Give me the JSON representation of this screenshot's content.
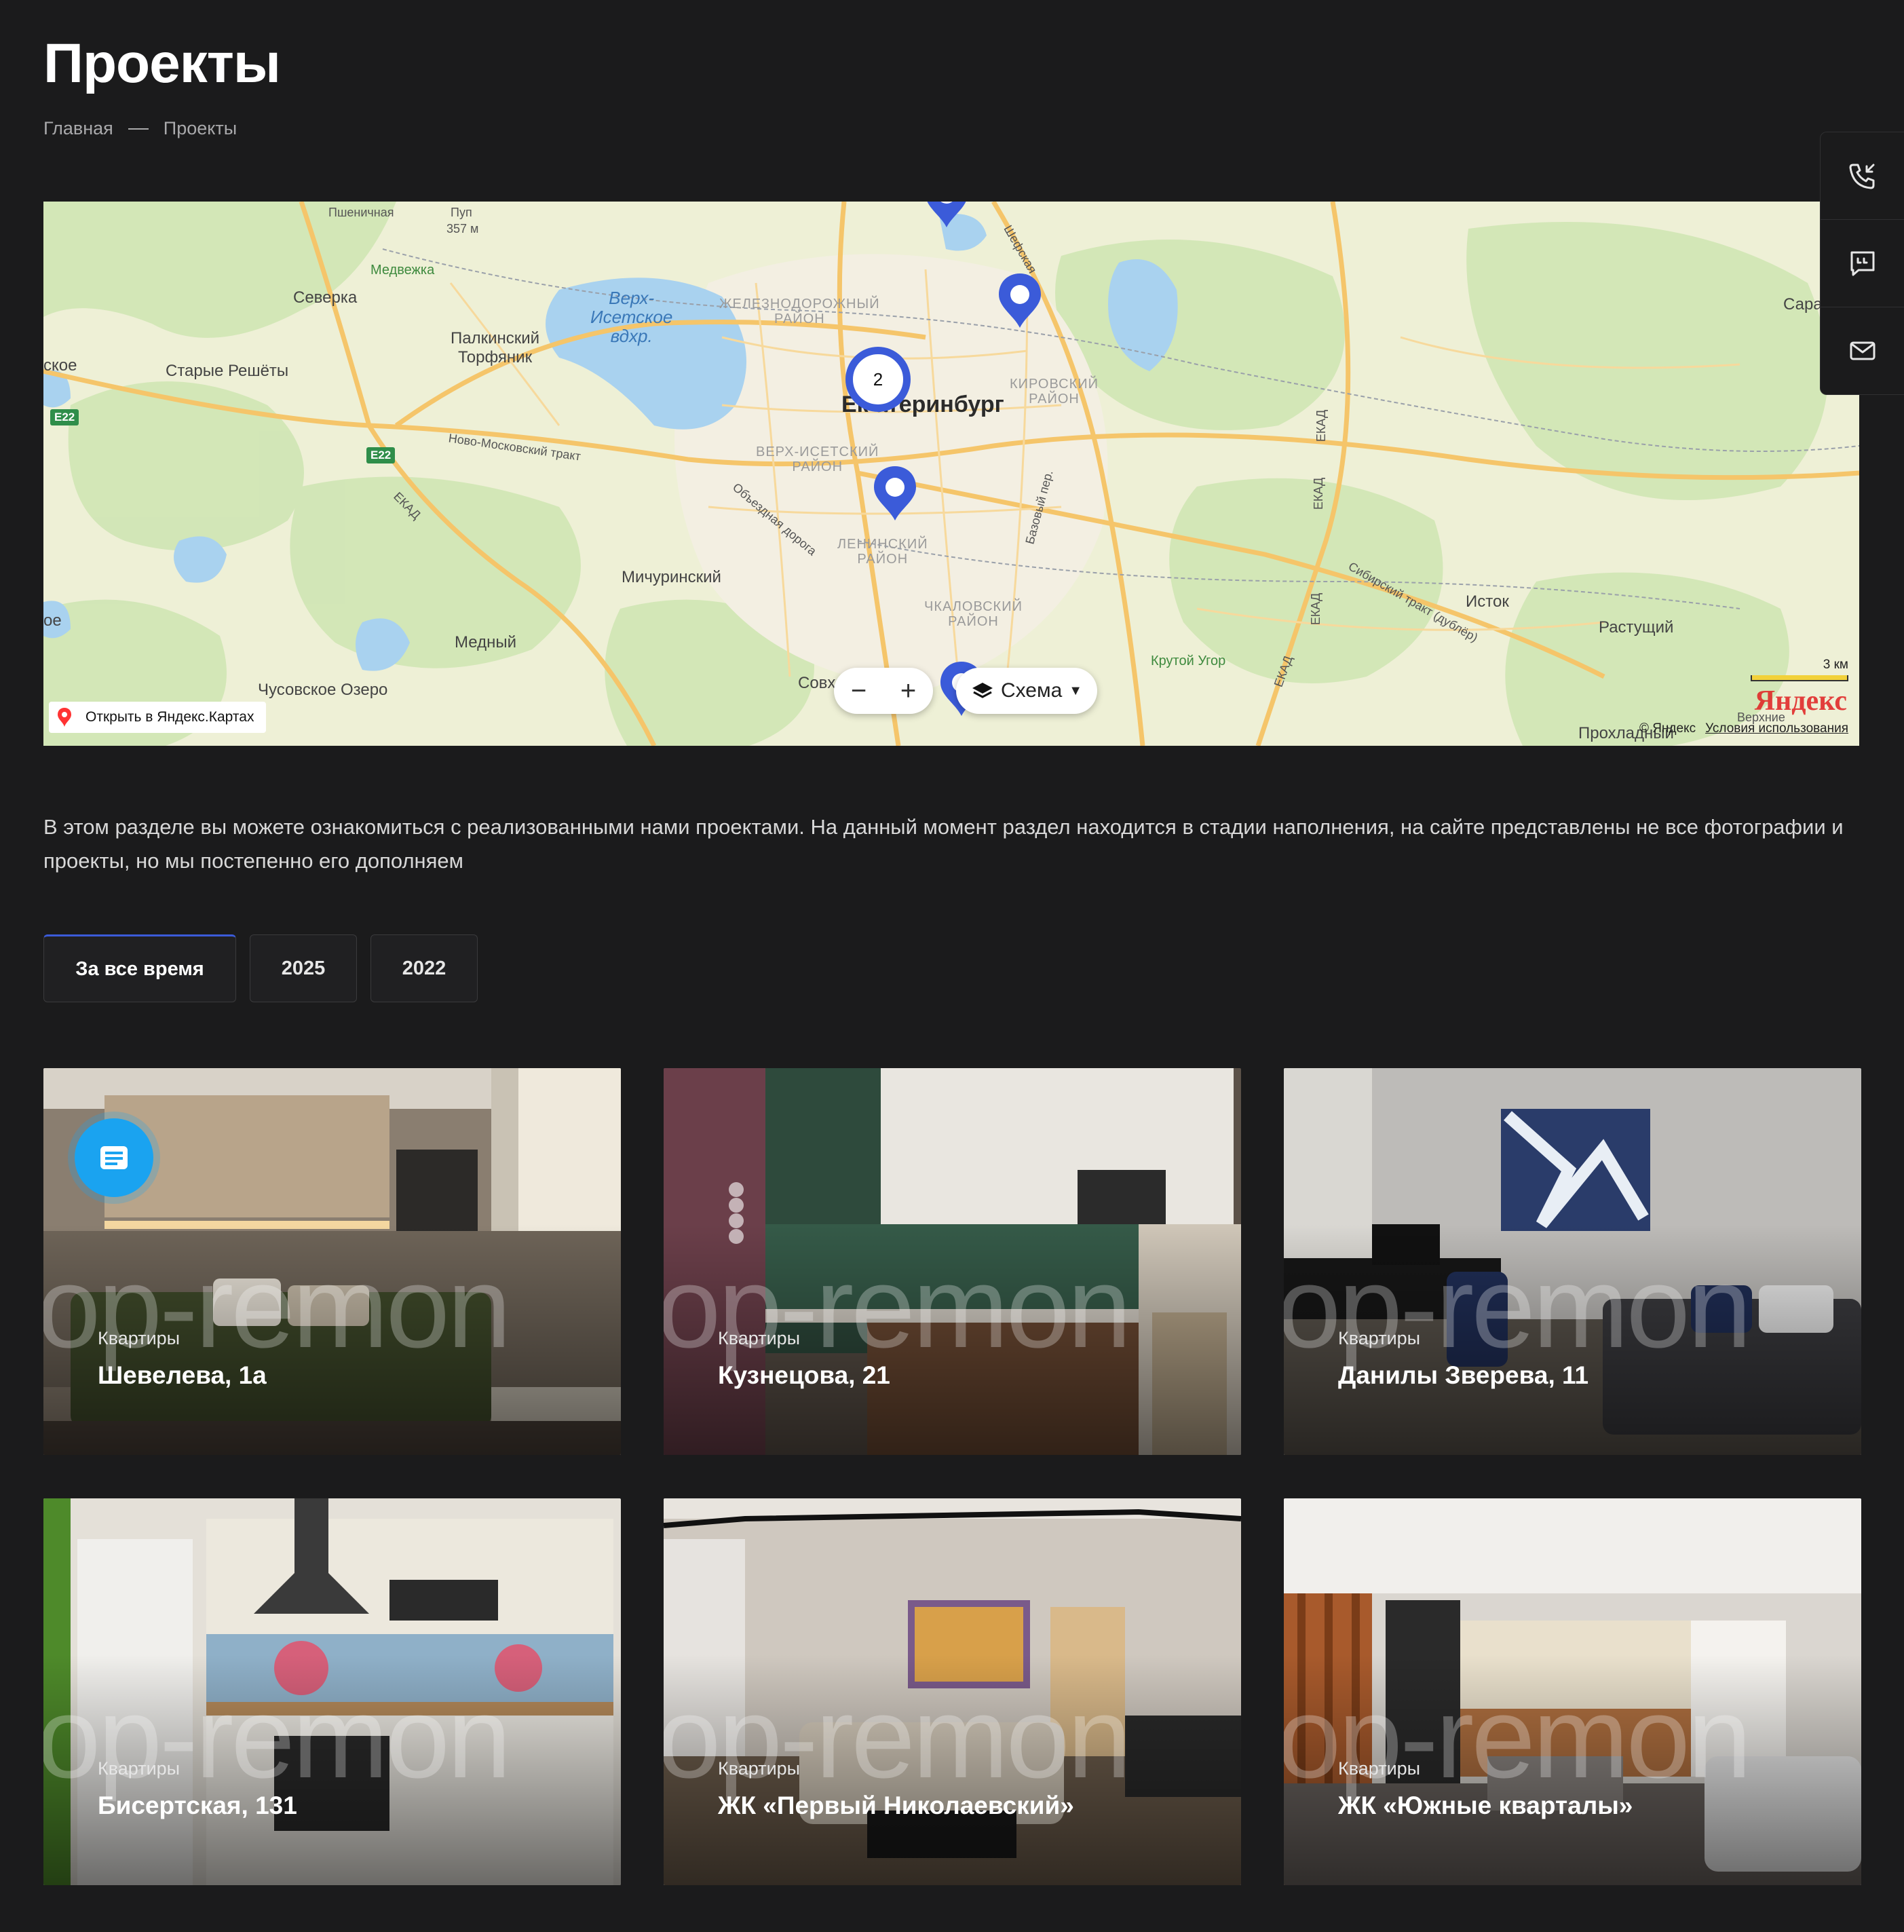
{
  "header": {
    "title": "Проекты"
  },
  "breadcrumb": {
    "home": "Главная",
    "current": "Проекты"
  },
  "map": {
    "labels": {
      "pshenichnaya": "Пшеничная",
      "pup": "Пуп",
      "pup_height": "357 м",
      "medvezhka": "Медвежка",
      "severka": "Северка",
      "reservoir": "Верх-\nИсетское\nвдхр.",
      "zheleznodorozhny": "ЖЕЛЕЗНОДОРОЖНЫЙ\nРАЙОН",
      "shefskaya": "Шефская",
      "palkinsky": "Палкинский\nТорфяник",
      "staroe_left": "ское",
      "starye_reshety": "Старые Решёты",
      "city": "Ек атеринбург",
      "kirovsky": "КИРОВСКИЙ\nРАЙОН",
      "novo_moskovsky": "Ново-Московский тракт",
      "verkh_isetsky": "ВЕРХ-ИСЕТСКИЙ\nРАЙОН",
      "ekad1": "ЕКАД",
      "ekad2": "ЕКАД",
      "ekad3": "ЕКАД",
      "ekad4": "ЕКАД",
      "ekad5": "ЕКАД",
      "obezdnaya": "Объездная дорога",
      "leninsky": "ЛЕНИНСКИЙ\nРАЙОН",
      "bazovy": "Базовый пер.",
      "michurinsky": "Мичуринский",
      "chkalovsky": "ЧКАЛОВСКИЙ\nРАЙОН",
      "sibirsky": "Сибирский тракт (дублёр)",
      "istok": "Исток",
      "rastushchy": "Растущий",
      "medny": "Медный",
      "krutoy_ugor": "Крутой Угор",
      "chusovskoe": "Чусовское Озеро",
      "sovkh": "Совх",
      "sara": "Сара",
      "oe_left": "ое",
      "prokhladny": "Прохладный",
      "verkhnie": "Верхние"
    },
    "road_e22": "E22",
    "cluster_count": "2",
    "zoom_out": "−",
    "zoom_in": "+",
    "scheme_label": "Схема",
    "open_link": "Открыть в Яндекс.Картах",
    "copyright": "© Яндекс",
    "terms": "Условия использования",
    "scale": "3 км",
    "logo": "Яндекс"
  },
  "side_widgets": [
    "phone-callback-icon",
    "chat-quote-icon",
    "mail-icon"
  ],
  "intro": "В этом разделе вы можете ознакомиться с реализованными нами проектами. На данный момент раздел находится в стадии наполнения, на сайте представлены не все фотографии и проекты, но мы постепенно его дополняем",
  "tabs": [
    {
      "label": "За все время",
      "active": true
    },
    {
      "label": "2025",
      "active": false
    },
    {
      "label": "2022",
      "active": false
    }
  ],
  "watermark": "op-remon",
  "projects": [
    {
      "category": "Квартиры",
      "title": "Шевелева, 1а"
    },
    {
      "category": "Квартиры",
      "title": "Кузнецова, 21"
    },
    {
      "category": "Квартиры",
      "title": "Данилы Зверева, 11"
    },
    {
      "category": "Квартиры",
      "title": "Бисертская, 131"
    },
    {
      "category": "Квартиры",
      "title": "ЖК «Первый Николаевский»"
    },
    {
      "category": "Квартиры",
      "title": "ЖК «Южные кварталы»"
    }
  ],
  "colors": {
    "accent": "#3b5bd9",
    "background": "#1b1b1c",
    "chat_button": "#1aa3f0"
  }
}
